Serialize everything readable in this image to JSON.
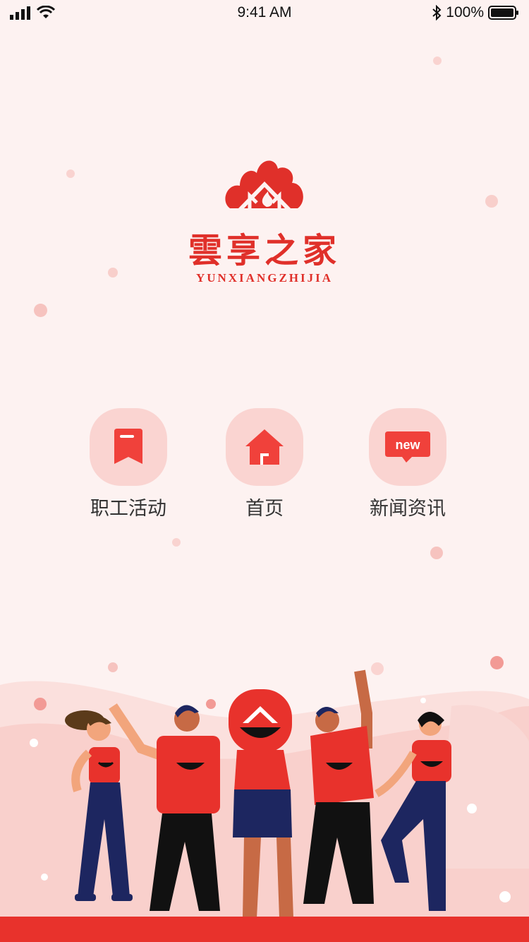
{
  "status_bar": {
    "time": "9:41 AM",
    "battery": "100%"
  },
  "app": {
    "title": "雲享之家",
    "subtitle": "YUNXIANGZHIJIA"
  },
  "menu": [
    {
      "label": "职工活动",
      "icon": "bookmark-icon"
    },
    {
      "label": "首页",
      "icon": "home-icon"
    },
    {
      "label": "新闻资讯",
      "icon": "new-badge-icon",
      "badge_text": "new"
    }
  ],
  "colors": {
    "brand": "#e0302a",
    "background": "#fdf2f1",
    "icon_bg": "#fad4d1",
    "bottom_bar": "#e8322c"
  }
}
